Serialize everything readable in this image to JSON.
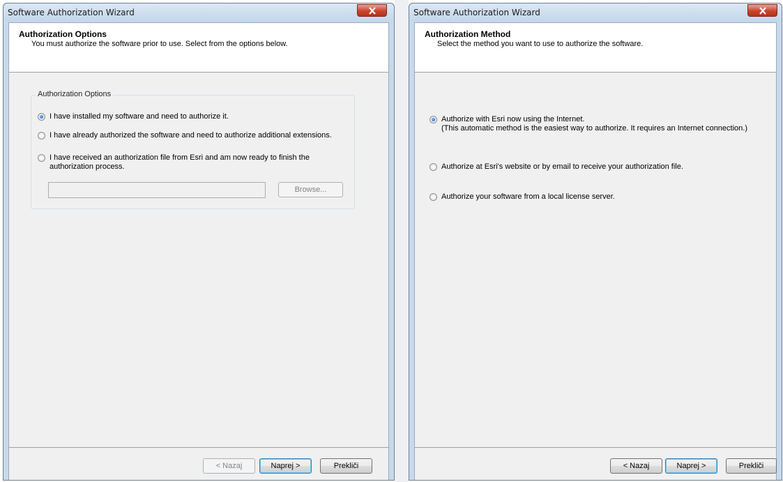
{
  "left_window": {
    "title": "Software Authorization Wizard",
    "header": {
      "title": "Authorization Options",
      "subtitle": "You must authorize the software prior to use. Select from the options below."
    },
    "group_label": "Authorization Options",
    "options": [
      {
        "label": "I have installed my software and need to authorize it.",
        "checked": true
      },
      {
        "label": "I have already authorized the software and need to authorize additional extensions.",
        "checked": false
      },
      {
        "label": "I have received an authorization file from Esri and am now ready to finish the authorization process.",
        "checked": false
      }
    ],
    "file_path_value": "",
    "browse_label": "Browse...",
    "back_label": "< Nazaj",
    "next_label": "Naprej >",
    "cancel_label": "Prekliči"
  },
  "right_window": {
    "title": "Software Authorization Wizard",
    "header": {
      "title": "Authorization Method",
      "subtitle": "Select the method you want to use to authorize the software."
    },
    "options": [
      {
        "label": "Authorize with Esri now using the Internet.",
        "note": "(This automatic method is the easiest way to authorize. It requires an Internet connection.)",
        "checked": true
      },
      {
        "label": "Authorize at Esri's website or by email to receive your authorization file.",
        "checked": false
      },
      {
        "label": "Authorize your software from a local license server.",
        "checked": false
      }
    ],
    "back_label": "< Nazaj",
    "next_label": "Naprej >",
    "cancel_label": "Prekliči"
  }
}
